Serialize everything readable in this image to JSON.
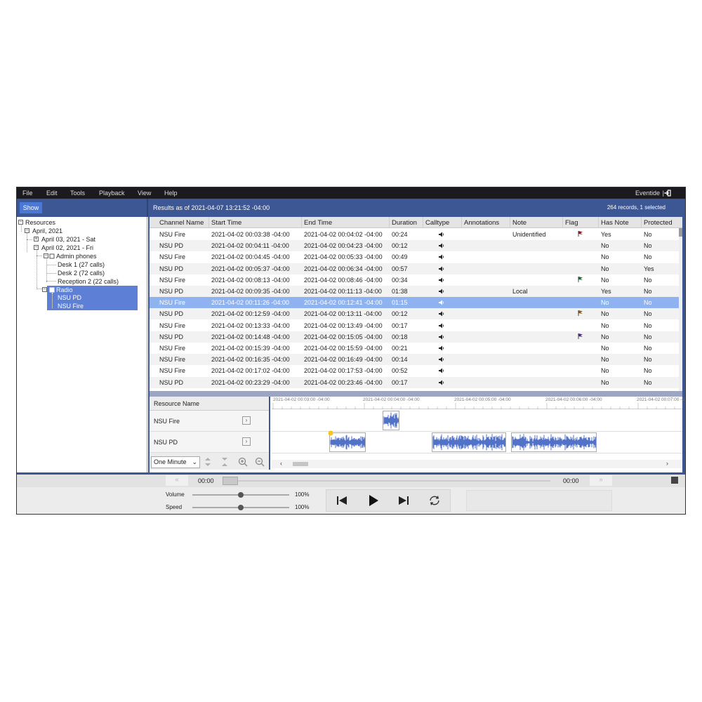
{
  "menu": {
    "items": [
      "File",
      "Edit",
      "Tools",
      "Playback",
      "View",
      "Help"
    ],
    "user": "Eventide",
    "separator": "|"
  },
  "toolbar": {
    "show_label": "Show",
    "results": "Results as of 2021-04-07 13:21:52 -04:00",
    "records": "264 records, 1 selected"
  },
  "tree": {
    "root": "Resources",
    "month": "April, 2021",
    "day1": "April 03, 2021 - Sat",
    "day2": "April 02, 2021 - Fri",
    "admin": "Admin phones",
    "desk1": "Desk 1 (27 calls)",
    "desk2": "Desk 2 (72 calls)",
    "reception2": "Reception 2 (22 calls)",
    "radio": "Radio",
    "nsu_pd": "NSU PD",
    "nsu_fire": "NSU Fire"
  },
  "table": {
    "columns": [
      "Channel Name",
      "Start Time",
      "End Time",
      "Duration",
      "Calltype",
      "Annotations",
      "Note",
      "Flag",
      "Has Note",
      "Protected"
    ],
    "rows": [
      {
        "channel": "NSU Fire",
        "start": "2021-04-02 00:03:38 -04:00",
        "end": "2021-04-02 00:04:02 -04:00",
        "duration": "00:24",
        "note": "Unidentified",
        "flag": "red",
        "has_note": "Yes",
        "protected": "No"
      },
      {
        "channel": "NSU PD",
        "start": "2021-04-02 00:04:11 -04:00",
        "end": "2021-04-02 00:04:23 -04:00",
        "duration": "00:12",
        "note": "",
        "flag": "",
        "has_note": "No",
        "protected": "No"
      },
      {
        "channel": "NSU Fire",
        "start": "2021-04-02 00:04:45 -04:00",
        "end": "2021-04-02 00:05:33 -04:00",
        "duration": "00:49",
        "note": "",
        "flag": "",
        "has_note": "No",
        "protected": "No"
      },
      {
        "channel": "NSU PD",
        "start": "2021-04-02 00:05:37 -04:00",
        "end": "2021-04-02 00:06:34 -04:00",
        "duration": "00:57",
        "note": "",
        "flag": "",
        "has_note": "No",
        "protected": "Yes"
      },
      {
        "channel": "NSU Fire",
        "start": "2021-04-02 00:08:13 -04:00",
        "end": "2021-04-02 00:08:46 -04:00",
        "duration": "00:34",
        "note": "",
        "flag": "green",
        "has_note": "No",
        "protected": "No"
      },
      {
        "channel": "NSU PD",
        "start": "2021-04-02 00:09:35 -04:00",
        "end": "2021-04-02 00:11:13 -04:00",
        "duration": "01:38",
        "note": "Local",
        "flag": "",
        "has_note": "Yes",
        "protected": "No"
      },
      {
        "channel": "NSU Fire",
        "start": "2021-04-02 00:11:26 -04:00",
        "end": "2021-04-02 00:12:41 -04:00",
        "duration": "01:15",
        "note": "",
        "flag": "",
        "has_note": "No",
        "protected": "No"
      },
      {
        "channel": "NSU PD",
        "start": "2021-04-02 00:12:59 -04:00",
        "end": "2021-04-02 00:13:11 -04:00",
        "duration": "00:12",
        "note": "",
        "flag": "orange",
        "has_note": "No",
        "protected": "No"
      },
      {
        "channel": "NSU Fire",
        "start": "2021-04-02 00:13:33 -04:00",
        "end": "2021-04-02 00:13:49 -04:00",
        "duration": "00:17",
        "note": "",
        "flag": "",
        "has_note": "No",
        "protected": "No"
      },
      {
        "channel": "NSU PD",
        "start": "2021-04-02 00:14:48 -04:00",
        "end": "2021-04-02 00:15:05 -04:00",
        "duration": "00:18",
        "note": "",
        "flag": "purple",
        "has_note": "No",
        "protected": "No"
      },
      {
        "channel": "NSU Fire",
        "start": "2021-04-02 00:15:39 -04:00",
        "end": "2021-04-02 00:15:59 -04:00",
        "duration": "00:21",
        "note": "",
        "flag": "",
        "has_note": "No",
        "protected": "No"
      },
      {
        "channel": "NSU Fire",
        "start": "2021-04-02 00:16:35 -04:00",
        "end": "2021-04-02 00:16:49 -04:00",
        "duration": "00:14",
        "note": "",
        "flag": "",
        "has_note": "No",
        "protected": "No"
      },
      {
        "channel": "NSU Fire",
        "start": "2021-04-02 00:17:02 -04:00",
        "end": "2021-04-02 00:17:53 -04:00",
        "duration": "00:52",
        "note": "",
        "flag": "",
        "has_note": "No",
        "protected": "No"
      },
      {
        "channel": "NSU PD",
        "start": "2021-04-02 00:23:29 -04:00",
        "end": "2021-04-02 00:23:46 -04:00",
        "duration": "00:17",
        "note": "",
        "flag": "",
        "has_note": "No",
        "protected": "No"
      }
    ],
    "selected_index": 6,
    "calltype_icon": "speaker-icon"
  },
  "timeline": {
    "resource_header": "Resource Name",
    "resources": [
      "NSU Fire",
      "NSU PD"
    ],
    "zoom_option": "One Minute",
    "ruler_labels": [
      "2021-04-02 00:03:00 -04:00",
      "2021-04-02 00:04:00 -04:00",
      "2021-04-02 00:05:00 -04:00",
      "2021-04-02 00:06:00 -04:00",
      "2021-04-02 00:07:00 -0"
    ]
  },
  "player": {
    "time_start": "00:00",
    "time_end": "00:00",
    "volume_label": "Volume",
    "volume_value": "100%",
    "speed_label": "Speed",
    "speed_value": "100%",
    "volume_level": 0.5,
    "speed_level": 0.5
  },
  "colors": {
    "accent": "#3d5694",
    "selection": "#8fb3f0",
    "tree_selection": "#5d7fd6",
    "waveform": "#3f63c2",
    "flag_red": "#8b1a1a",
    "flag_green": "#1a6b2a",
    "flag_orange": "#8a5a10",
    "flag_purple": "#4b2a7a"
  }
}
